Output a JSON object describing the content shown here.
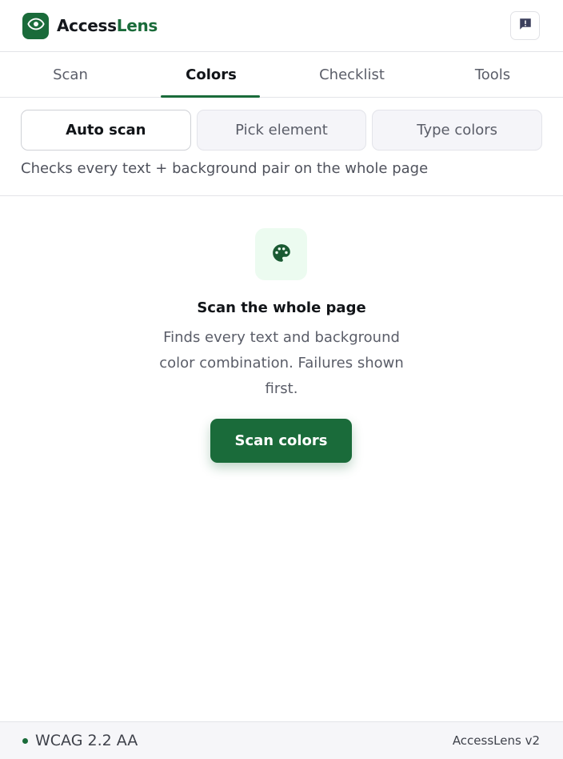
{
  "header": {
    "brand_part1": "Access",
    "brand_part2": "Lens",
    "logo_icon": "eye-icon",
    "feedback_icon": "feedback-icon"
  },
  "tabs": [
    {
      "label": "Scan",
      "active": false
    },
    {
      "label": "Colors",
      "active": true
    },
    {
      "label": "Checklist",
      "active": false
    },
    {
      "label": "Tools",
      "active": false
    }
  ],
  "modes": [
    {
      "label": "Auto scan",
      "active": true
    },
    {
      "label": "Pick element",
      "active": false
    },
    {
      "label": "Type colors",
      "active": false
    }
  ],
  "mode_description": "Checks every text + background pair on the whole page",
  "empty_state": {
    "icon": "palette-icon",
    "title": "Scan the whole page",
    "description": "Finds every text and background color combination. Failures shown first.",
    "button_label": "Scan colors"
  },
  "footer": {
    "standard": "WCAG 2.2 AA",
    "version": "AccessLens v2"
  },
  "colors": {
    "accent": "#1a6b3a",
    "accent_light_bg": "#ecfbf0",
    "footer_bg": "#f6f6f9"
  }
}
